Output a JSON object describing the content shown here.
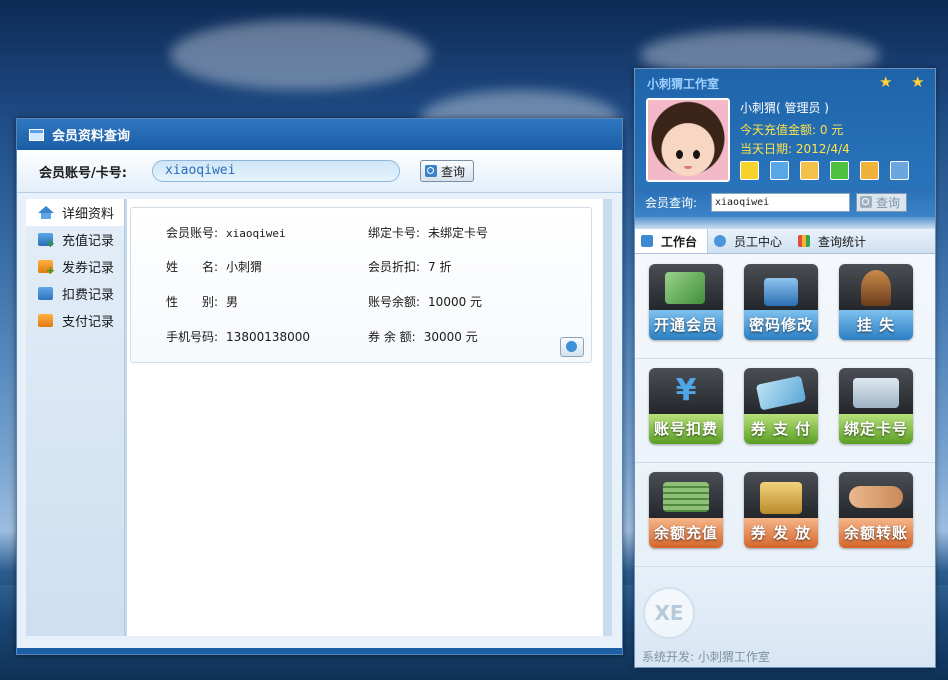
{
  "query_window": {
    "title": "会员资料查询",
    "search_label": "会员账号/卡号:",
    "search_value": "xiaoqiwei",
    "search_button": "查询",
    "nav": [
      {
        "label": "详细资料",
        "icon": "house-icon"
      },
      {
        "label": "充值记录",
        "icon": "recharge-icon"
      },
      {
        "label": "发券记录",
        "icon": "coupon-icon"
      },
      {
        "label": "扣费记录",
        "icon": "rss-icon"
      },
      {
        "label": "支付记录",
        "icon": "rss-orange-icon"
      }
    ],
    "details": {
      "account_label": "会员账号:",
      "account_value": "xiaoqiwei",
      "card_label": "绑定卡号:",
      "card_value": "未绑定卡号",
      "name_label": "姓　　名:",
      "name_value": "小刺猬",
      "discount_label": "会员折扣:",
      "discount_value": "7 折",
      "gender_label": "性　　别:",
      "gender_value": "男",
      "balance_label": "账号余额:",
      "balance_value": "10000 元",
      "phone_label": "手机号码:",
      "phone_value": "13800138000",
      "coupon_label": "券 余 额:",
      "coupon_value": "30000 元"
    }
  },
  "side_panel": {
    "title": "小刺猬工作室",
    "user_name": "小刺猬( 管理员 )",
    "today_recharge": "今天充值金额: 0 元",
    "today_date": "当天日期: 2012/4/4",
    "member_query_label": "会员查询:",
    "member_query_value": "xiaoqiwei",
    "member_query_button": "查询",
    "tabs": [
      "工作台",
      "员工中心",
      "查询统计"
    ],
    "tiles": [
      {
        "label": "开通会员",
        "color": "blue"
      },
      {
        "label": "密码修改",
        "color": "blue"
      },
      {
        "label": "挂 失",
        "color": "blue"
      },
      {
        "label": "账号扣费",
        "color": "green"
      },
      {
        "label": "券 支 付",
        "color": "green"
      },
      {
        "label": "绑定卡号",
        "color": "green"
      },
      {
        "label": "余额充值",
        "color": "orange"
      },
      {
        "label": "券 发 放",
        "color": "orange"
      },
      {
        "label": "余额转账",
        "color": "orange"
      }
    ],
    "logo_text": "XE",
    "footer": "系统开发: 小刺猬工作室"
  }
}
